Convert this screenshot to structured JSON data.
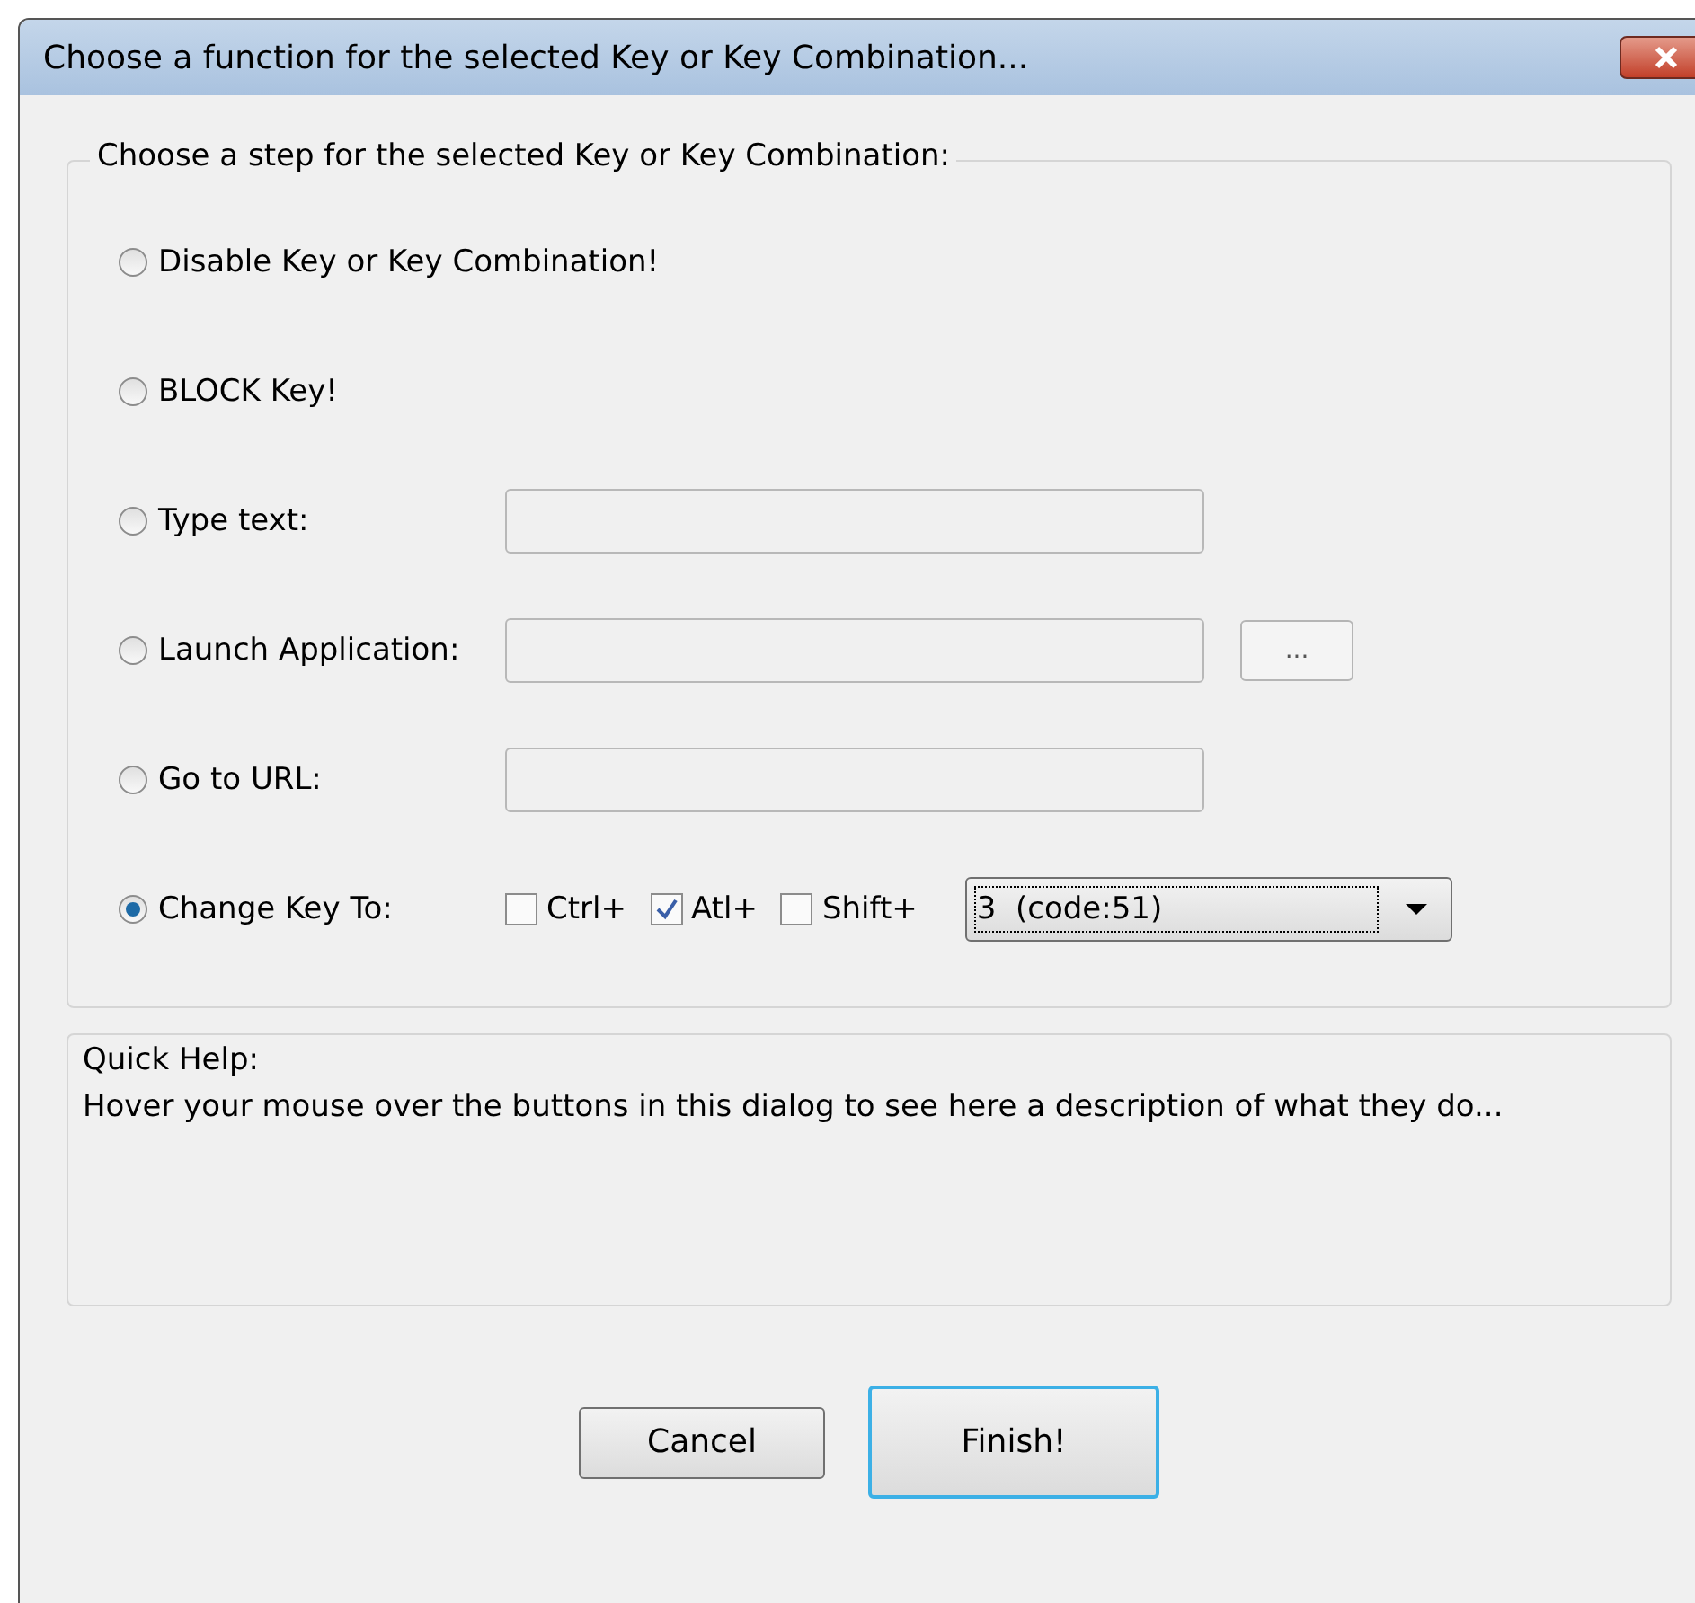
{
  "window": {
    "title": "Choose a function for the selected Key or Key Combination..."
  },
  "step_group": {
    "title": "Choose a step for the selected Key or Key Combination:",
    "options": [
      {
        "label": "Disable Key or Key Combination!",
        "selected": false,
        "kind": "plain"
      },
      {
        "label": "BLOCK Key!",
        "selected": false,
        "kind": "plain"
      },
      {
        "label": "Type text:",
        "selected": false,
        "kind": "text"
      },
      {
        "label": "Launch Application:",
        "selected": false,
        "kind": "browse",
        "browse_label": "..."
      },
      {
        "label": "Go to URL:",
        "selected": false,
        "kind": "text"
      },
      {
        "label": "Change Key To:",
        "selected": true,
        "kind": "keychange"
      }
    ],
    "modifiers": [
      {
        "label": "Ctrl+",
        "checked": false
      },
      {
        "label": "Atl+",
        "checked": true
      },
      {
        "label": "Shift+",
        "checked": false
      }
    ],
    "key_select": {
      "value": "3  (code:51)"
    }
  },
  "quick_help": {
    "title": "Quick Help:",
    "text": "Hover your mouse over the buttons in this dialog to see here a description of what they do..."
  },
  "buttons": [
    {
      "label": "Cancel",
      "default": false
    },
    {
      "label": "Finish!",
      "default": true
    }
  ]
}
